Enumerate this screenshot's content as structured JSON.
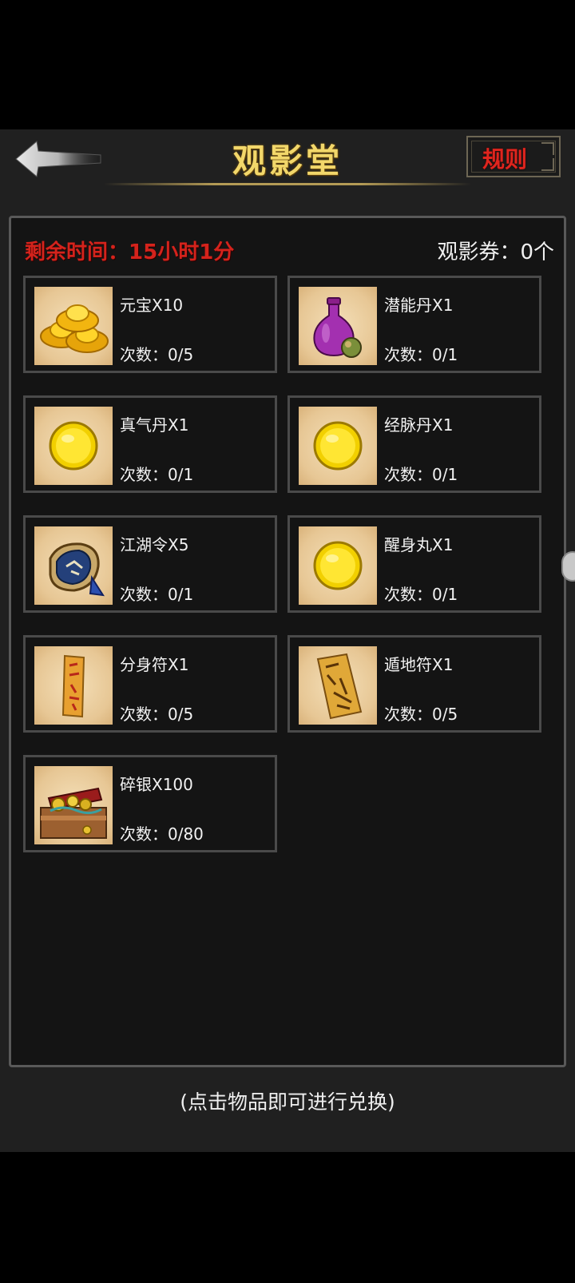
{
  "header": {
    "title": "观影堂",
    "back_icon": "back-arrow-icon",
    "rules_label": "规则"
  },
  "status": {
    "time_label": "剩余时间：",
    "time_value": "15小时1分",
    "ticket_text": "观影券：0个"
  },
  "items": [
    {
      "name": "元宝X10",
      "count": "次数：0/5",
      "icon": "gold-ingot-icon"
    },
    {
      "name": "潜能丹X1",
      "count": "次数：0/1",
      "icon": "purple-vase-icon"
    },
    {
      "name": "真气丹X1",
      "count": "次数：0/1",
      "icon": "golden-pill-icon"
    },
    {
      "name": "经脉丹X1",
      "count": "次数：0/1",
      "icon": "golden-pill-icon"
    },
    {
      "name": "江湖令X5",
      "count": "次数：0/1",
      "icon": "token-pouch-icon"
    },
    {
      "name": "醒身丸X1",
      "count": "次数：0/1",
      "icon": "golden-pill-icon"
    },
    {
      "name": "分身符X1",
      "count": "次数：0/5",
      "icon": "talisman-icon"
    },
    {
      "name": "遁地符X1",
      "count": "次数：0/5",
      "icon": "earth-talisman-icon"
    },
    {
      "name": "碎银X100",
      "count": "次数：0/80",
      "icon": "treasure-chest-icon"
    }
  ],
  "footer": {
    "hint": "(点击物品即可进行兑换)"
  },
  "colors": {
    "background": "#202020",
    "panel": "#141414",
    "title_gold": "#f2d76a",
    "alert_red": "#d4231c"
  }
}
